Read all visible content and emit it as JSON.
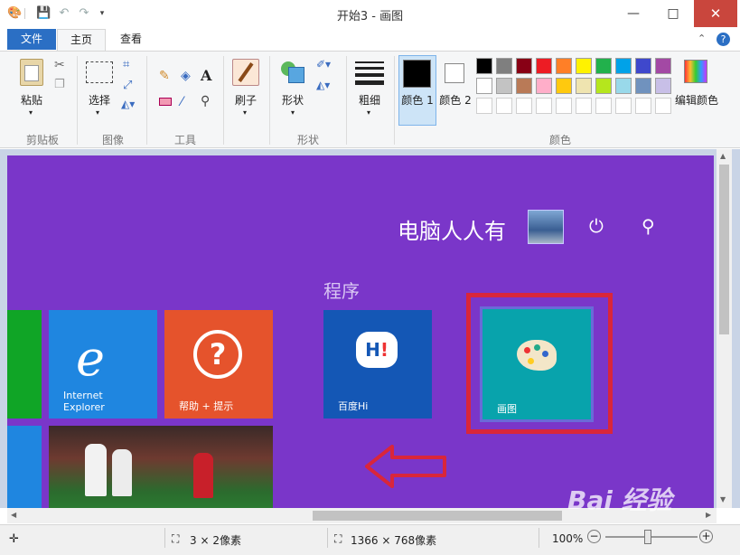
{
  "window": {
    "title": "开始3 - 画图",
    "minimize_icon": "minimize-icon",
    "maximize_icon": "maximize-icon",
    "close_icon": "close-icon"
  },
  "ribbon_tabs": {
    "file": "文件",
    "home": "主页",
    "view": "查看"
  },
  "clipboard": {
    "paste": "粘贴",
    "group": "剪贴板"
  },
  "image": {
    "select": "选择",
    "group": "图像"
  },
  "tools": {
    "group": "工具"
  },
  "brushes": {
    "label": "刷子"
  },
  "shapes": {
    "shapes_label": "形状",
    "group": "形状"
  },
  "size": {
    "label": "粗细"
  },
  "colors": {
    "color1": "颜色 1",
    "color2": "颜色 2",
    "edit": "编辑颜色",
    "group": "颜色",
    "palette_row1": [
      "#000000",
      "#7f7f7f",
      "#880015",
      "#ed1c24",
      "#ff7f27",
      "#fff200",
      "#22b14c",
      "#00a2e8",
      "#3f48cc",
      "#a349a4"
    ],
    "palette_row2": [
      "#ffffff",
      "#c3c3c3",
      "#b97a57",
      "#ffaec9",
      "#ffc90e",
      "#efe4b0",
      "#b5e61d",
      "#99d9ea",
      "#7092be",
      "#c8bfe7"
    ]
  },
  "start_screen": {
    "user_name": "电脑人人有",
    "section_label": "程序",
    "tiles": {
      "ie": "Internet Explorer",
      "help": "帮助 + 提示",
      "baidu_hi": "百度Hi",
      "paint": "画图"
    },
    "accent": "#7a36c9"
  },
  "status": {
    "selection_size": "3 × 2像素",
    "image_size": "1366 × 768像素",
    "zoom": "100%"
  },
  "watermark": "Bai 经验"
}
